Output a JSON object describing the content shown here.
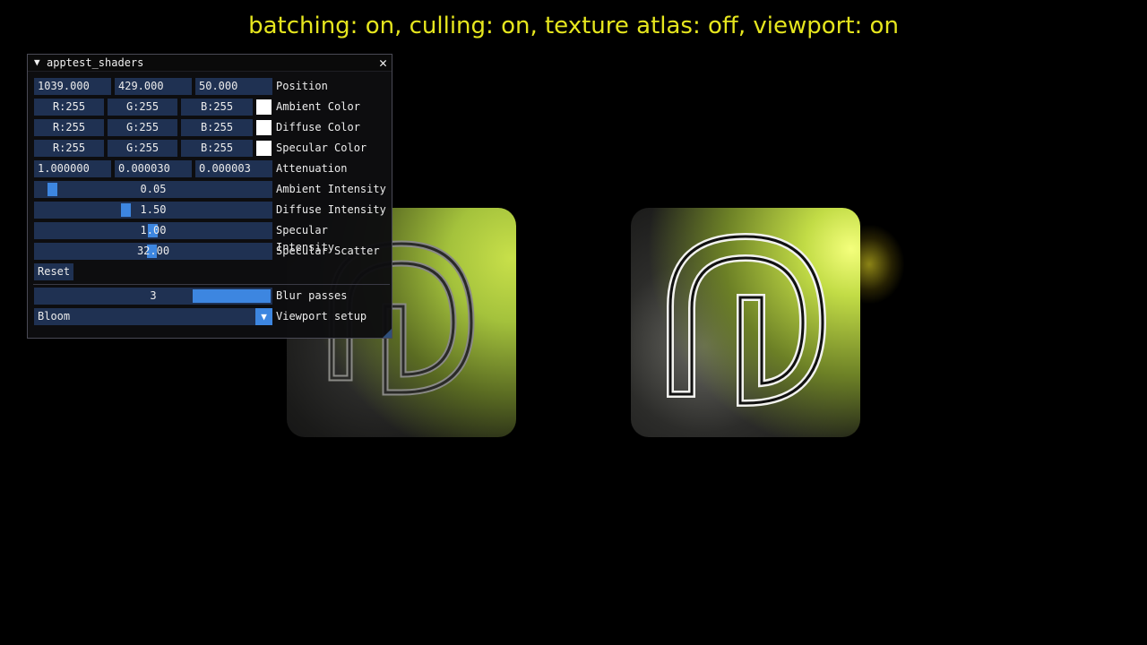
{
  "status_line": "batching: on, culling: on, texture atlas: off, viewport: on",
  "panel": {
    "title": "apptest_shaders",
    "collapse_icon": "triangle-down-icon",
    "close_icon": "close-icon",
    "position": {
      "x": "1039.000",
      "y": "429.000",
      "z": "50.000",
      "label": "Position"
    },
    "ambient_color": {
      "r": "R:255",
      "g": "G:255",
      "b": "B:255",
      "swatch": "#ffffff",
      "label": "Ambient Color"
    },
    "diffuse_color": {
      "r": "R:255",
      "g": "G:255",
      "b": "B:255",
      "swatch": "#ffffff",
      "label": "Diffuse Color"
    },
    "specular_color": {
      "r": "R:255",
      "g": "G:255",
      "b": "B:255",
      "swatch": "#ffffff",
      "label": "Specular Color"
    },
    "attenuation": {
      "a": "1.000000",
      "b": "0.000030",
      "c": "0.000003",
      "label": "Attenuation"
    },
    "ambient_intensity": {
      "value": "0.05",
      "label": "Ambient Intensity"
    },
    "diffuse_intensity": {
      "value": "1.50",
      "label": "Diffuse Intensity"
    },
    "specular_intensity": {
      "value": "1.00",
      "label": "Specular Intensity"
    },
    "specular_scatter": {
      "value": "32.00",
      "label": "Specular Scatter"
    },
    "reset_label": "Reset",
    "blur_passes": {
      "value": "3",
      "label": "Blur passes"
    },
    "viewport_setup": {
      "value": "Bloom",
      "label": "Viewport setup"
    }
  },
  "colors": {
    "status_text": "#e6e61e",
    "field_bg": "#1f3152",
    "accent": "#3d86e0",
    "sprite_glow": "#c2dc46"
  }
}
